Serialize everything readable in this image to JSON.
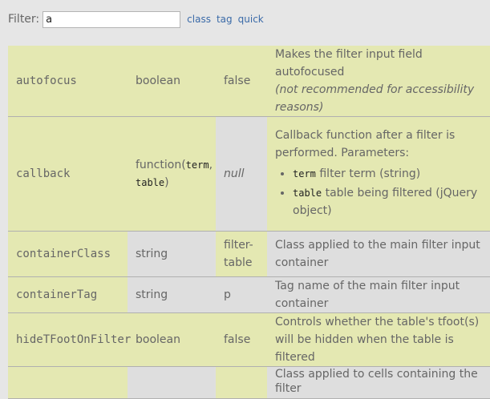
{
  "filter": {
    "label": "Filter:",
    "value": "a",
    "links": [
      "class",
      "tag",
      "quick"
    ]
  },
  "rows": [
    {
      "name": "autofocus",
      "type": "boolean",
      "default": "false",
      "description": "Makes the filter input field autofocused",
      "note": "(not recommended for accessibility reasons)"
    },
    {
      "name": "callback",
      "type_text": "function(",
      "type_code1": "term",
      "type_sep": ",",
      "type_code2": "table",
      "type_end": ")",
      "default": "null",
      "description": "Callback function after a filter is performed. Parameters:",
      "params": [
        {
          "code": "term",
          "text": " filter term (string)"
        },
        {
          "code": "table",
          "text": " table being filtered (jQuery object)"
        }
      ]
    },
    {
      "name": "containerClass",
      "type": "string",
      "default": "filter-table",
      "description": "Class applied to the main filter input container"
    },
    {
      "name": "containerTag",
      "type": "string",
      "default": "p",
      "description": "Tag name of the main filter input container"
    },
    {
      "name": "hideTFootOnFilter",
      "type": "boolean",
      "default": "false",
      "description": "Controls whether the table's tfoot(s) will be hidden when the table is filtered"
    },
    {
      "name": "",
      "type": "",
      "default": "",
      "description": "Class applied to cells containing the filter"
    }
  ]
}
